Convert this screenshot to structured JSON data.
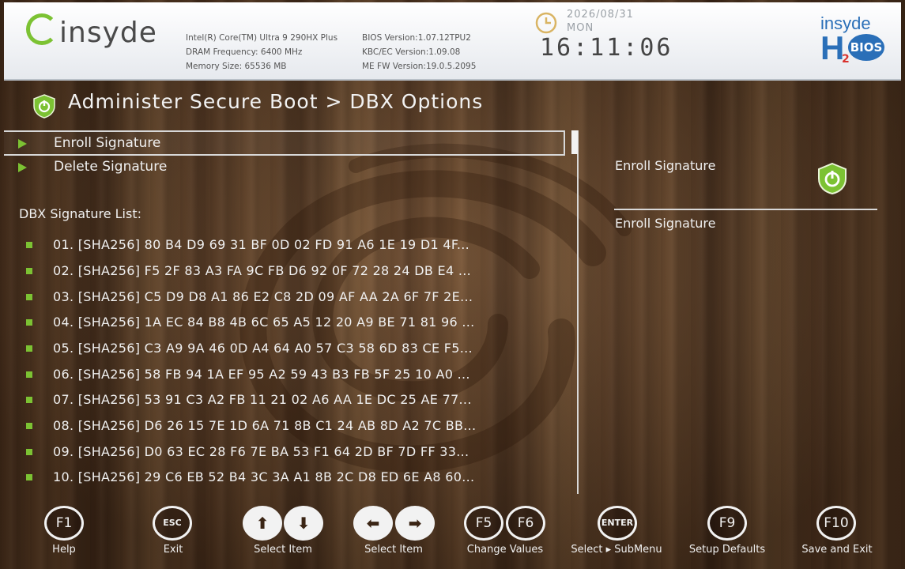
{
  "header": {
    "logo_text": "insyde",
    "cpu": "Intel(R) Core(TM) Ultra 9 290HX Plus",
    "dram": "DRAM Frequency: 6400 MHz",
    "memory": "Memory Size: 65536 MB",
    "bios_version": "BIOS Version:1.07.12TPU2",
    "kbc_version": "KBC/EC Version:1.09.08",
    "me_version": "ME FW Version:19.0.5.2095",
    "date": "2026/08/31",
    "day": "MON",
    "time": "16:11:06",
    "brand_top": "insyde",
    "brand_h": "H",
    "brand_sub": "2",
    "brand_bios": "BIOS"
  },
  "page": {
    "title": "Administer Secure Boot > DBX Options"
  },
  "menu": [
    {
      "label": "Enroll Signature",
      "selected": true
    },
    {
      "label": "Delete Signature",
      "selected": false
    }
  ],
  "list_heading": "DBX Signature List:",
  "signatures": [
    "01. [SHA256] 80 B4 D9 69 31 BF 0D 02 FD 91 A6 1E 19 D1 4F...",
    "02. [SHA256] F5 2F 83 A3 FA 9C FB D6 92 0F 72 28 24 DB E4 ...",
    "03. [SHA256] C5 D9 D8 A1 86 E2 C8 2D 09 AF AA 2A 6F 7F 2E...",
    "04. [SHA256] 1A EC 84 B8 4B 6C 65 A5 12 20 A9 BE 71 81 96 ...",
    "05. [SHA256] C3 A9 9A 46 0D A4 64 A0 57 C3 58 6D 83 CE F5...",
    "06. [SHA256] 58 FB 94 1A EF 95 A2 59 43 B3 FB 5F 25 10 A0 ...",
    "07. [SHA256] 53 91 C3 A2 FB 11 21 02 A6 AA 1E DC 25 AE 77...",
    "08. [SHA256] D6 26 15 7E 1D 6A 71 8B C1 24 AB 8D A2 7C BB...",
    "09. [SHA256] D0 63 EC 28 F6 7E BA 53 F1 64 2D BF 7D FF 33...",
    "10. [SHA256] 29 C6 EB 52 B4 3C 3A A1 8B 2C D8 ED 6E A8 60..."
  ],
  "help": {
    "title": "Enroll Signature",
    "description": "Enroll Signature"
  },
  "footer": {
    "keys": {
      "f1": "F1",
      "esc": "ESC",
      "f5": "F5",
      "f6": "F6",
      "enter": "ENTER",
      "f9": "F9",
      "f10": "F10"
    },
    "labels": {
      "help": "Help",
      "exit": "Exit",
      "select_item_v": "Select Item",
      "select_item_h": "Select Item",
      "change_values": "Change Values",
      "select_submenu": "Select ▸ SubMenu",
      "setup_defaults": "Setup Defaults",
      "save_exit": "Save and Exit"
    }
  },
  "colors": {
    "accent": "#7cc233",
    "text": "#f0f0f0",
    "brand_blue": "#2a6fb8"
  }
}
